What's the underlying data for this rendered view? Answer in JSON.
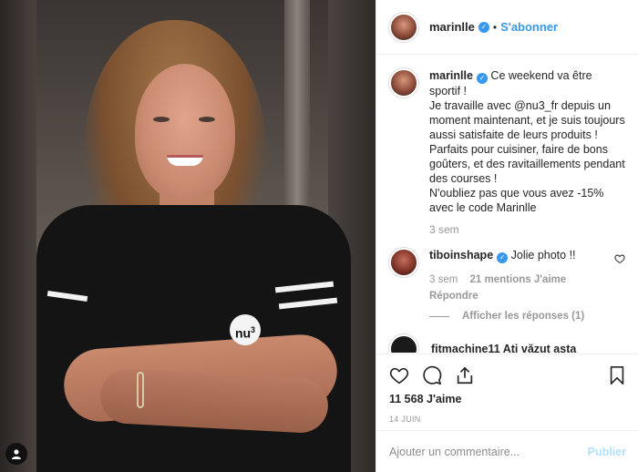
{
  "header": {
    "username": "marinlle",
    "verified_mark": "✓",
    "dot": "•",
    "follow_label": "S'abonner"
  },
  "caption": {
    "username": "marinlle",
    "text": "Ce weekend va être sportif !\nJe travaille avec @nu3_fr depuis un moment maintenant, et je suis toujours aussi satisfaite de leurs produits ! Parfaits pour cuisiner, faire de bons goûters, et des ravitaillements pendant des courses !\nN'oubliez pas que vous avez -15% avec le code Marinlle",
    "time": "3 sem"
  },
  "comment1": {
    "username": "tiboinshape",
    "text": "Jolie photo !!",
    "time": "3 sem",
    "likes": "21 mentions J'aime",
    "reply_label": "Répondre",
    "view_replies": "Afficher les réponses (1)"
  },
  "comment2_partial": {
    "text": "fitmachine11 Ați văzut asta"
  },
  "photo": {
    "brand_badge": "nu"
  },
  "actions": {
    "likes": "11 568 J'aime",
    "date": "14 JUIN"
  },
  "add_comment": {
    "placeholder": "Ajouter un commentaire...",
    "post_label": "Publier"
  },
  "colors": {
    "accent": "#3897f0",
    "post_disabled": "#b2dffc"
  }
}
